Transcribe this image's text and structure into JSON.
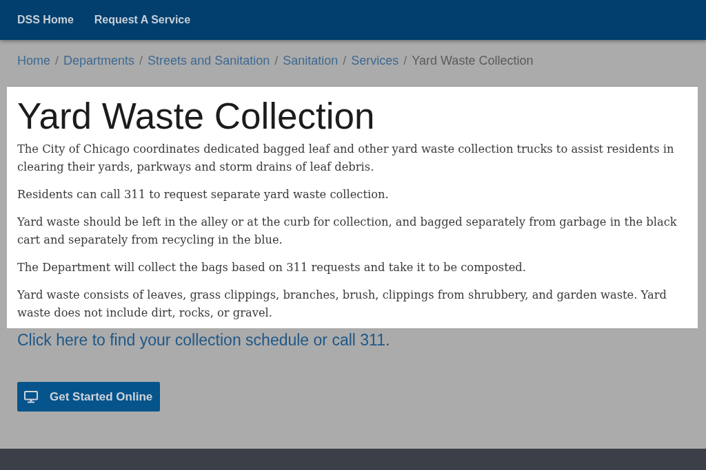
{
  "nav": {
    "items": [
      {
        "label": "DSS Home"
      },
      {
        "label": "Request A Service"
      }
    ]
  },
  "breadcrumb": [
    {
      "kind": "link",
      "text": "Home"
    },
    {
      "kind": "separator",
      "text": "/"
    },
    {
      "kind": "link",
      "text": "Departments"
    },
    {
      "kind": "separator",
      "text": "/"
    },
    {
      "kind": "link",
      "text": "Streets and Sanitation"
    },
    {
      "kind": "separator",
      "text": "/"
    },
    {
      "kind": "link",
      "text": "Sanitation"
    },
    {
      "kind": "separator",
      "text": "/"
    },
    {
      "kind": "link",
      "text": "Services"
    },
    {
      "kind": "separator",
      "text": "/"
    },
    {
      "kind": "current",
      "text": "Yard Waste Collection"
    }
  ],
  "article": {
    "title": "Yard Waste Collection",
    "paragraphs": [
      "The City of Chicago coordinates dedicated bagged leaf and other yard waste collection trucks to assist residents in clearing their yards, parkways and storm drains of leaf debris.",
      "Residents can call 311 to request separate yard waste collection.",
      "Yard waste should be left in the alley or at the curb for collection, and bagged separately from garbage in the black cart and separately from recycling in the blue.",
      "The Department will collect the bags based on 311 requests and take it to be composted.",
      "Yard waste consists of leaves, grass clippings, branches, brush, clippings from shrubbery, and garden waste. Yard waste does not include dirt, rocks, or gravel."
    ]
  },
  "schedule_line": {
    "link": "Click here to find your collection schedule or call 311",
    "after": "."
  },
  "action_button": {
    "label": "Get Started Online"
  }
}
